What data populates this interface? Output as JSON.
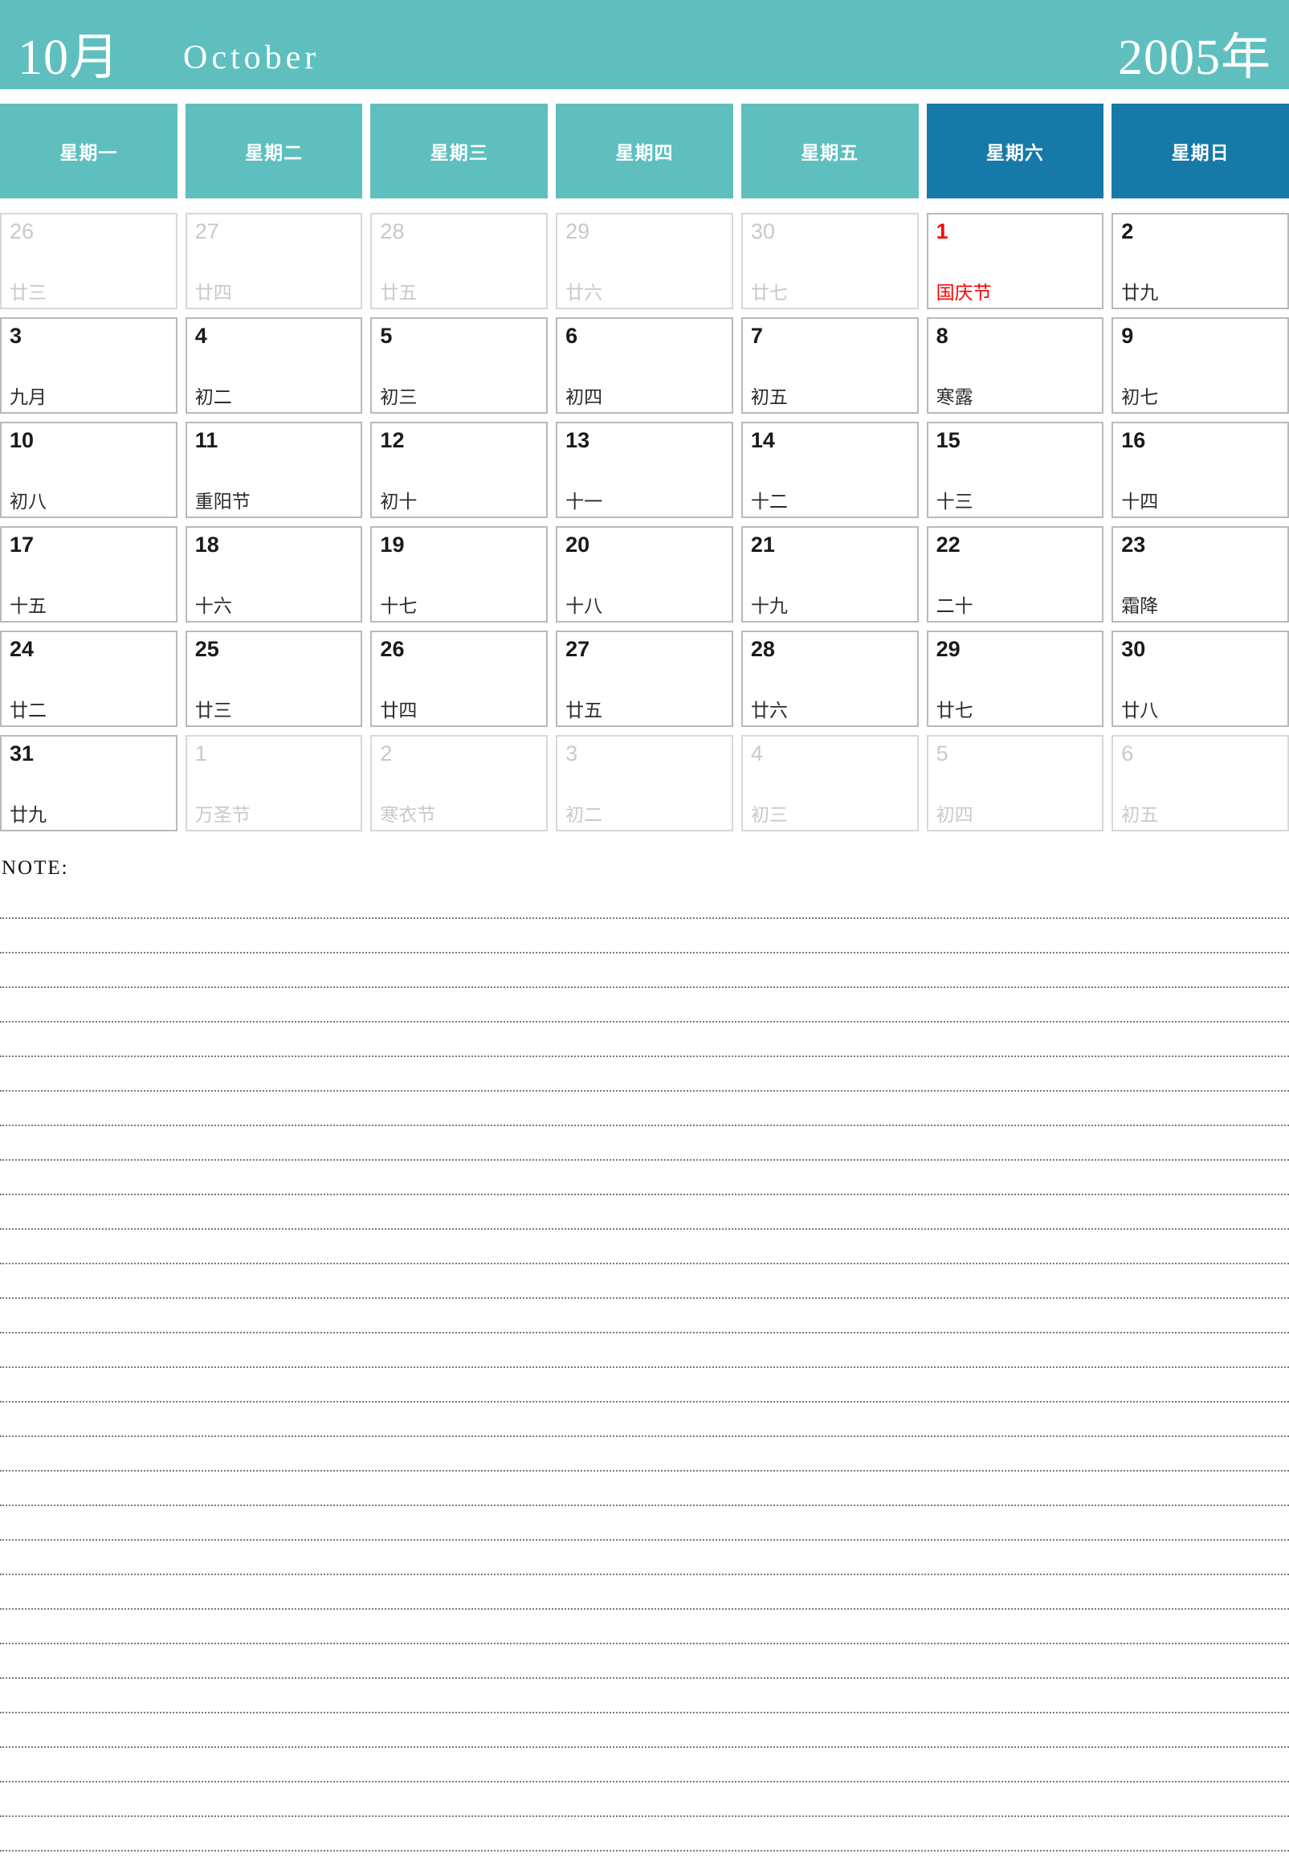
{
  "header": {
    "month_cn": "10月",
    "month_en": "October",
    "year_cn": "2005年",
    "banner_color": "#5fbfbf",
    "weekend_color": "#1779a8"
  },
  "weekdays": [
    {
      "label": "星期一",
      "weekend": false
    },
    {
      "label": "星期二",
      "weekend": false
    },
    {
      "label": "星期三",
      "weekend": false
    },
    {
      "label": "星期四",
      "weekend": false
    },
    {
      "label": "星期五",
      "weekend": false
    },
    {
      "label": "星期六",
      "weekend": true
    },
    {
      "label": "星期日",
      "weekend": true
    }
  ],
  "weeks": [
    [
      {
        "num": "26",
        "lunar": "廿三",
        "muted": true,
        "holiday": false
      },
      {
        "num": "27",
        "lunar": "廿四",
        "muted": true,
        "holiday": false
      },
      {
        "num": "28",
        "lunar": "廿五",
        "muted": true,
        "holiday": false
      },
      {
        "num": "29",
        "lunar": "廿六",
        "muted": true,
        "holiday": false
      },
      {
        "num": "30",
        "lunar": "廿七",
        "muted": true,
        "holiday": false
      },
      {
        "num": "1",
        "lunar": "国庆节",
        "muted": false,
        "holiday": true
      },
      {
        "num": "2",
        "lunar": "廿九",
        "muted": false,
        "holiday": false
      }
    ],
    [
      {
        "num": "3",
        "lunar": "九月",
        "muted": false,
        "holiday": false
      },
      {
        "num": "4",
        "lunar": "初二",
        "muted": false,
        "holiday": false
      },
      {
        "num": "5",
        "lunar": "初三",
        "muted": false,
        "holiday": false
      },
      {
        "num": "6",
        "lunar": "初四",
        "muted": false,
        "holiday": false
      },
      {
        "num": "7",
        "lunar": "初五",
        "muted": false,
        "holiday": false
      },
      {
        "num": "8",
        "lunar": "寒露",
        "muted": false,
        "holiday": false
      },
      {
        "num": "9",
        "lunar": "初七",
        "muted": false,
        "holiday": false
      }
    ],
    [
      {
        "num": "10",
        "lunar": "初八",
        "muted": false,
        "holiday": false
      },
      {
        "num": "11",
        "lunar": "重阳节",
        "muted": false,
        "holiday": false
      },
      {
        "num": "12",
        "lunar": "初十",
        "muted": false,
        "holiday": false
      },
      {
        "num": "13",
        "lunar": "十一",
        "muted": false,
        "holiday": false
      },
      {
        "num": "14",
        "lunar": "十二",
        "muted": false,
        "holiday": false
      },
      {
        "num": "15",
        "lunar": "十三",
        "muted": false,
        "holiday": false
      },
      {
        "num": "16",
        "lunar": "十四",
        "muted": false,
        "holiday": false
      }
    ],
    [
      {
        "num": "17",
        "lunar": "十五",
        "muted": false,
        "holiday": false
      },
      {
        "num": "18",
        "lunar": "十六",
        "muted": false,
        "holiday": false
      },
      {
        "num": "19",
        "lunar": "十七",
        "muted": false,
        "holiday": false
      },
      {
        "num": "20",
        "lunar": "十八",
        "muted": false,
        "holiday": false
      },
      {
        "num": "21",
        "lunar": "十九",
        "muted": false,
        "holiday": false
      },
      {
        "num": "22",
        "lunar": "二十",
        "muted": false,
        "holiday": false
      },
      {
        "num": "23",
        "lunar": "霜降",
        "muted": false,
        "holiday": false
      }
    ],
    [
      {
        "num": "24",
        "lunar": "廿二",
        "muted": false,
        "holiday": false
      },
      {
        "num": "25",
        "lunar": "廿三",
        "muted": false,
        "holiday": false
      },
      {
        "num": "26",
        "lunar": "廿四",
        "muted": false,
        "holiday": false
      },
      {
        "num": "27",
        "lunar": "廿五",
        "muted": false,
        "holiday": false
      },
      {
        "num": "28",
        "lunar": "廿六",
        "muted": false,
        "holiday": false
      },
      {
        "num": "29",
        "lunar": "廿七",
        "muted": false,
        "holiday": false
      },
      {
        "num": "30",
        "lunar": "廿八",
        "muted": false,
        "holiday": false
      }
    ],
    [
      {
        "num": "31",
        "lunar": "廿九",
        "muted": false,
        "holiday": false
      },
      {
        "num": "1",
        "lunar": "万圣节",
        "muted": true,
        "holiday": false
      },
      {
        "num": "2",
        "lunar": "寒衣节",
        "muted": true,
        "holiday": false
      },
      {
        "num": "3",
        "lunar": "初二",
        "muted": true,
        "holiday": false
      },
      {
        "num": "4",
        "lunar": "初三",
        "muted": true,
        "holiday": false
      },
      {
        "num": "5",
        "lunar": "初四",
        "muted": true,
        "holiday": false
      },
      {
        "num": "6",
        "lunar": "初五",
        "muted": true,
        "holiday": false
      }
    ]
  ],
  "note": {
    "label": "NOTE:",
    "line_count": 28
  }
}
